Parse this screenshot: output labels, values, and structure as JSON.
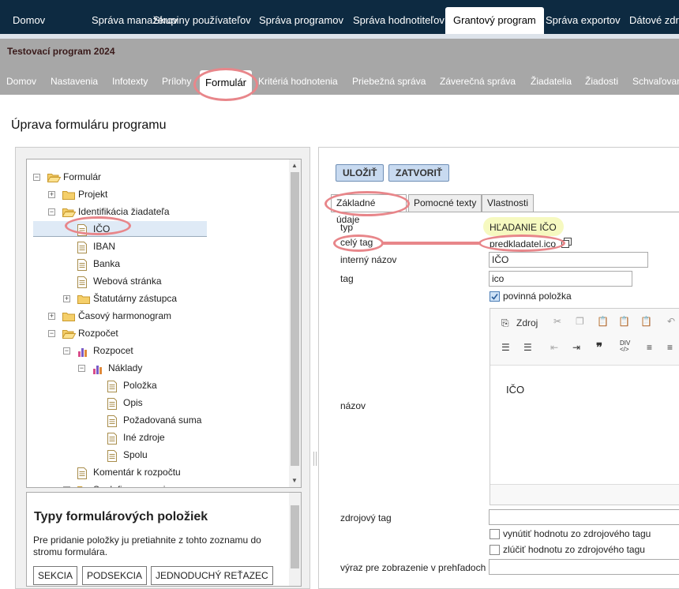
{
  "top_nav": [
    "Domov",
    "Správa manažérov",
    "Skupiny používateľov",
    "Správa programov",
    "Správa hodnotiteľov",
    "Grantový program",
    "Správa exportov",
    "Dátové zdr"
  ],
  "program": {
    "title": "Testovací program 2024",
    "tabs": [
      "Domov",
      "Nastavenia",
      "Infotexty",
      "Prílohy",
      "Formulár",
      "Kritériá hodnotenia",
      "Priebežná správa",
      "Záverečná správa",
      "Žiadatelia",
      "Žiadosti",
      "Schvaľovan"
    ]
  },
  "page_title": "Úprava formuláru programu",
  "tree": [
    {
      "label": "Formulár",
      "icon": "folder-open-icon",
      "toggle": "−"
    },
    {
      "label": "Projekt",
      "icon": "folder-icon",
      "toggle": "+"
    },
    {
      "label": "Identifikácia žiadateľa",
      "icon": "folder-open-icon",
      "toggle": "−"
    },
    {
      "label": "IČO",
      "icon": "document-icon",
      "toggle": ""
    },
    {
      "label": "IBAN",
      "icon": "document-icon",
      "toggle": ""
    },
    {
      "label": "Banka",
      "icon": "document-icon",
      "toggle": ""
    },
    {
      "label": "Webová stránka",
      "icon": "document-icon",
      "toggle": ""
    },
    {
      "label": "Štatutárny zástupca",
      "icon": "folder-icon",
      "toggle": "+"
    },
    {
      "label": "Časový harmonogram",
      "icon": "folder-icon",
      "toggle": "+"
    },
    {
      "label": "Rozpočet",
      "icon": "folder-open-icon",
      "toggle": "−"
    },
    {
      "label": "Rozpocet",
      "icon": "chart-icon",
      "toggle": "−"
    },
    {
      "label": "Náklady",
      "icon": "chart-icon",
      "toggle": "−"
    },
    {
      "label": "Položka",
      "icon": "document-icon",
      "toggle": ""
    },
    {
      "label": "Opis",
      "icon": "document-icon",
      "toggle": ""
    },
    {
      "label": "Požadovaná suma",
      "icon": "document-icon",
      "toggle": ""
    },
    {
      "label": "Iné zdroje",
      "icon": "document-icon",
      "toggle": ""
    },
    {
      "label": "Spolu",
      "icon": "document-icon",
      "toggle": ""
    },
    {
      "label": "Komentár k rozpočtu",
      "icon": "document-icon",
      "toggle": ""
    },
    {
      "label": "Spolufinancovanie",
      "icon": "folder-icon",
      "toggle": "+"
    }
  ],
  "types": {
    "title": "Typy formulárových položiek",
    "description": "Pre pridanie položky ju pretiahnite z tohto zoznamu do stromu formulára.",
    "buttons": [
      "SEKCIA",
      "PODSEKCIA",
      "JEDNODUCHÝ REŤAZEC"
    ]
  },
  "actions": {
    "save": "ULOŽIŤ",
    "close": "ZATVORIŤ"
  },
  "tabs": [
    "Základné údaje",
    "Pomocné texty",
    "Vlastnosti"
  ],
  "form": {
    "typ_label": "typ",
    "typ_value": "HĽADANIE IČO",
    "fulltag_label": "celý tag",
    "fulltag_value": "predkladatel.ico",
    "internal_label": "interný názov",
    "internal_value": "IČO",
    "tag_label": "tag",
    "tag_value": "ico",
    "required_label": "povinná položka",
    "name_label": "názov",
    "name_value": "IČO",
    "source_label": "zdrojový tag",
    "force_label": "vynútiť hodnotu zo zdrojového tagu",
    "merge_label": "zlúčiť hodnotu zo zdrojového tagu",
    "overview_label": "výraz pre zobrazenie v prehľadoch"
  },
  "editor": {
    "source_label": "Zdroj"
  },
  "colors": {
    "topnav": "#0d2a41",
    "program_bar": "#a7a7a7",
    "button": "#c8daf0",
    "annotation": "#e8868a"
  }
}
